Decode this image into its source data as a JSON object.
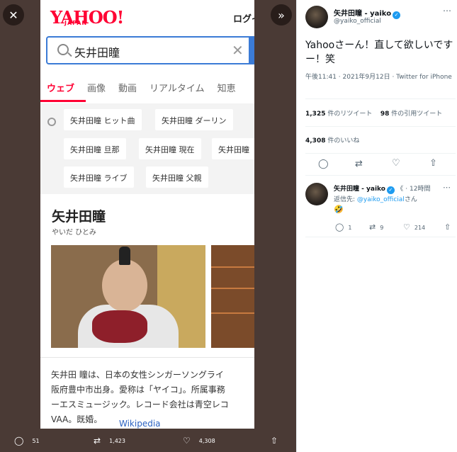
{
  "viewer": {
    "close_icon": "close-icon",
    "expand_icon": "chevrons-right-icon",
    "actions": {
      "reply_count": "51",
      "retweet_count": "1,423",
      "like_count": "4,308"
    }
  },
  "yahoo": {
    "logo": "YAHOO!",
    "logo_sub": "JAPAN",
    "login": "ログイ",
    "search_value": "矢井田瞳",
    "tabs": [
      "ウェブ",
      "画像",
      "動画",
      "リアルタイム",
      "知恵"
    ],
    "related": [
      "矢井田瞳 ヒット曲",
      "矢井田瞳 ダーリン",
      "矢井田瞳 旦那",
      "矢井田瞳 現在",
      "矢井田瞳",
      "矢井田瞳 ライブ",
      "矢井田瞳 父親"
    ],
    "kp_title": "矢井田瞳",
    "kp_reading": "やいだ ひとみ",
    "kp_description": "矢井田 瞳は、日本の女性シンガーソングライ\n阪府豊中市出身。愛称は「ヤイコ」。所属事務\nーエスミュージック。レコード会社は青空レコ\nVAA。既婚。",
    "kp_source": "Wikipedia"
  },
  "tweet": {
    "name": "矢井田瞳 - yaiko",
    "verified": "✓",
    "handle": "@yaiko_official",
    "text": "Yahooさーん！直して欲しいですー！笑",
    "time": "午後11:41 · 2021年9月12日 · Twitter for iPhone",
    "retweets": "1,325",
    "retweets_label": "件のリツイート",
    "quotes": "98",
    "quotes_label": "件の引用ツイート",
    "likes": "4,308",
    "likes_label": "件のいいね"
  },
  "reply": {
    "name": "矢井田瞳 - yaiko",
    "handle": "《",
    "time": "· 12時間",
    "reply_to_prefix": "返信先: ",
    "reply_to": "@yaiko_official",
    "reply_to_suffix": "さん",
    "emoji": "🤣",
    "reply_count": "1",
    "retweet_count": "9",
    "like_count": "214"
  }
}
